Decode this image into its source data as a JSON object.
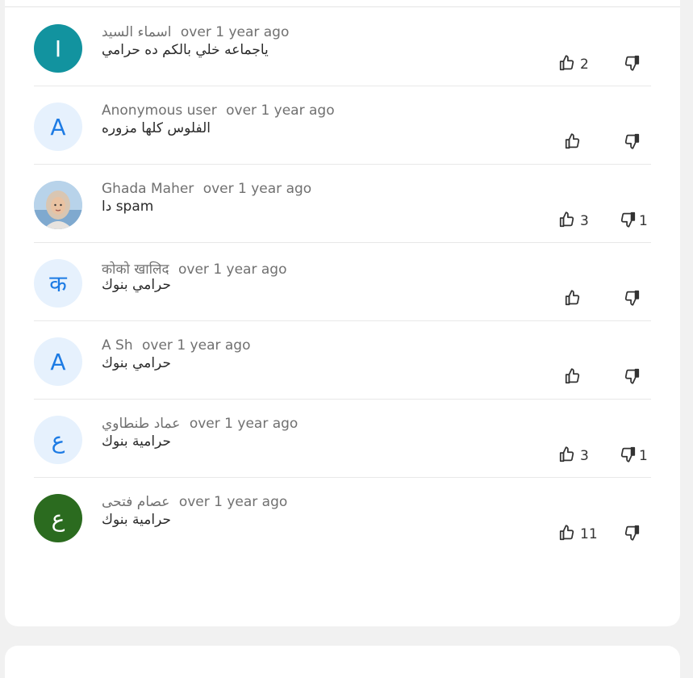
{
  "comments": [
    {
      "avatar_letter": "I",
      "avatar_style": "teal",
      "author": "اسماء السيد",
      "separator": "",
      "time": "over 1 year ago",
      "text": "ياجماعه خلي بالكم ده حرامي",
      "likes": "2",
      "dislikes": ""
    },
    {
      "avatar_letter": "A",
      "avatar_style": "light",
      "author": "Anonymous user",
      "separator": "",
      "time": "over 1 year ago",
      "text": "الفلوس كلها مزوره",
      "likes": "",
      "dislikes": ""
    },
    {
      "avatar_letter": "",
      "avatar_style": "photo",
      "author": "Ghada Maher",
      "separator": "",
      "time": "over 1 year ago",
      "text": "دا spam",
      "likes": "3",
      "dislikes": "1"
    },
    {
      "avatar_letter": "क",
      "avatar_style": "light",
      "author": "कोको खालिद",
      "separator": "",
      "time": "over 1 year ago",
      "text": "حرامي بنوك",
      "likes": "",
      "dislikes": ""
    },
    {
      "avatar_letter": "A",
      "avatar_style": "light",
      "author": "A Sh",
      "separator": "",
      "time": "over 1 year ago",
      "text": "حرامي بنوك",
      "likes": "",
      "dislikes": ""
    },
    {
      "avatar_letter": "ع",
      "avatar_style": "light",
      "author": "عماد طنطاوي",
      "separator": "",
      "time": "over 1 year ago",
      "text": "حرامية بنوك",
      "likes": "3",
      "dislikes": "1"
    },
    {
      "avatar_letter": "ع",
      "avatar_style": "green",
      "author": "عصام فتحى",
      "separator": "",
      "time": "over 1 year ago",
      "text": "حرامية بنوك",
      "likes": "11",
      "dislikes": ""
    }
  ],
  "icons": {
    "like": "thumbs-up-icon",
    "dislike": "thumbs-down-icon"
  },
  "colors": {
    "teal_avatar": "#12939f",
    "light_avatar_bg": "#e6f1fd",
    "light_avatar_fg": "#1d7be4",
    "green_avatar": "#2b6b1f"
  }
}
